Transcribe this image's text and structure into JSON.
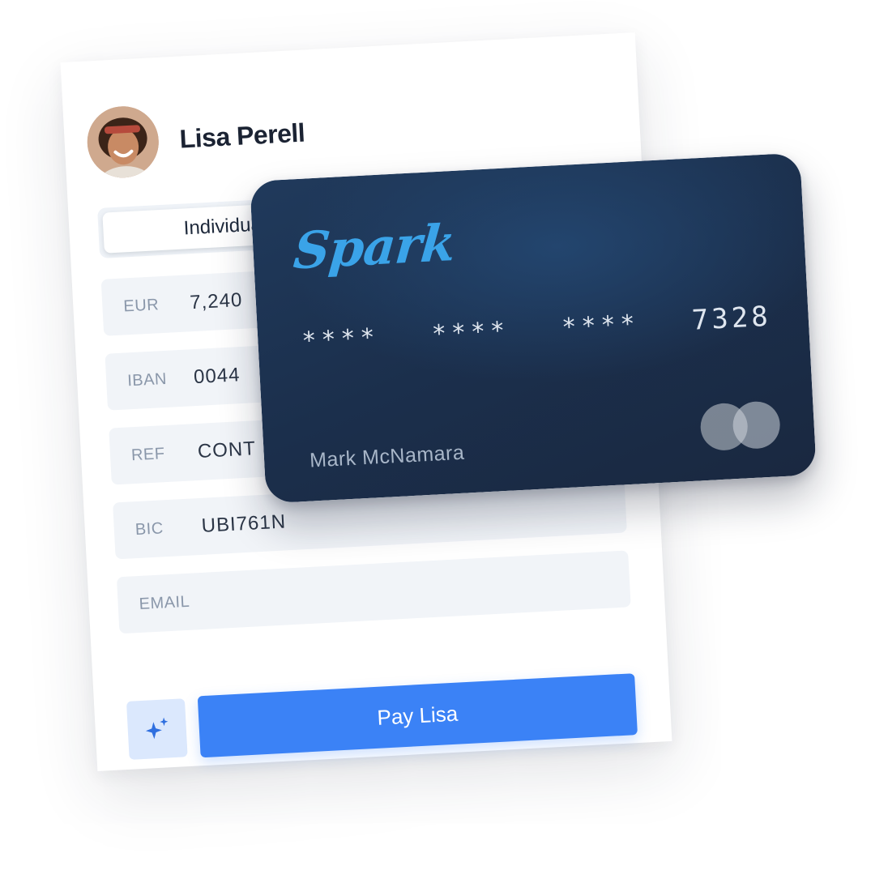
{
  "profile": {
    "name": "Lisa Perell"
  },
  "tabs": {
    "active_label": "Individual"
  },
  "fields": [
    {
      "label": "EUR",
      "value": "7,240"
    },
    {
      "label": "IBAN",
      "value": "0044"
    },
    {
      "label": "REF",
      "value": "CONT"
    },
    {
      "label": "BIC",
      "value": "UBI761N"
    },
    {
      "label": "EMAIL",
      "value": ""
    }
  ],
  "actions": {
    "sparkle_icon": "sparkle-icon",
    "pay_label": "Pay Lisa"
  },
  "card": {
    "brand": "Spark",
    "groups": [
      "****",
      "****",
      "****",
      "7328"
    ],
    "holder": "Mark McNamara",
    "network_icon": "mastercard-logo-icon"
  },
  "colors": {
    "accent": "#3b82f6",
    "card_bg": "#1e3556",
    "brand": "#3aa3e8"
  }
}
